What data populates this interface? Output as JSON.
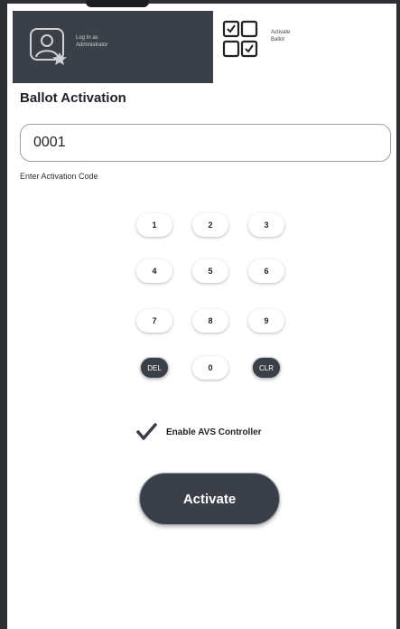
{
  "header": {
    "admin_tab": {
      "line1": "Log In as",
      "line2": "Administrator"
    },
    "activate_tab": {
      "line1": "Activate",
      "line2": "Ballot"
    }
  },
  "main": {
    "title": "Ballot Activation",
    "code_input": {
      "value": "0001"
    },
    "input_label": "Enter Activation Code",
    "keypad": {
      "keys": [
        "1",
        "2",
        "3",
        "4",
        "5",
        "6",
        "7",
        "8",
        "9",
        "DEL",
        "0",
        "CLR"
      ]
    },
    "avs_checkbox": {
      "label": "Enable AVS Controller",
      "checked": true
    },
    "activate_button": "Activate"
  },
  "colors": {
    "dark": "#3a3f48",
    "frame": "#2d2f33",
    "text": "#1e2126"
  }
}
